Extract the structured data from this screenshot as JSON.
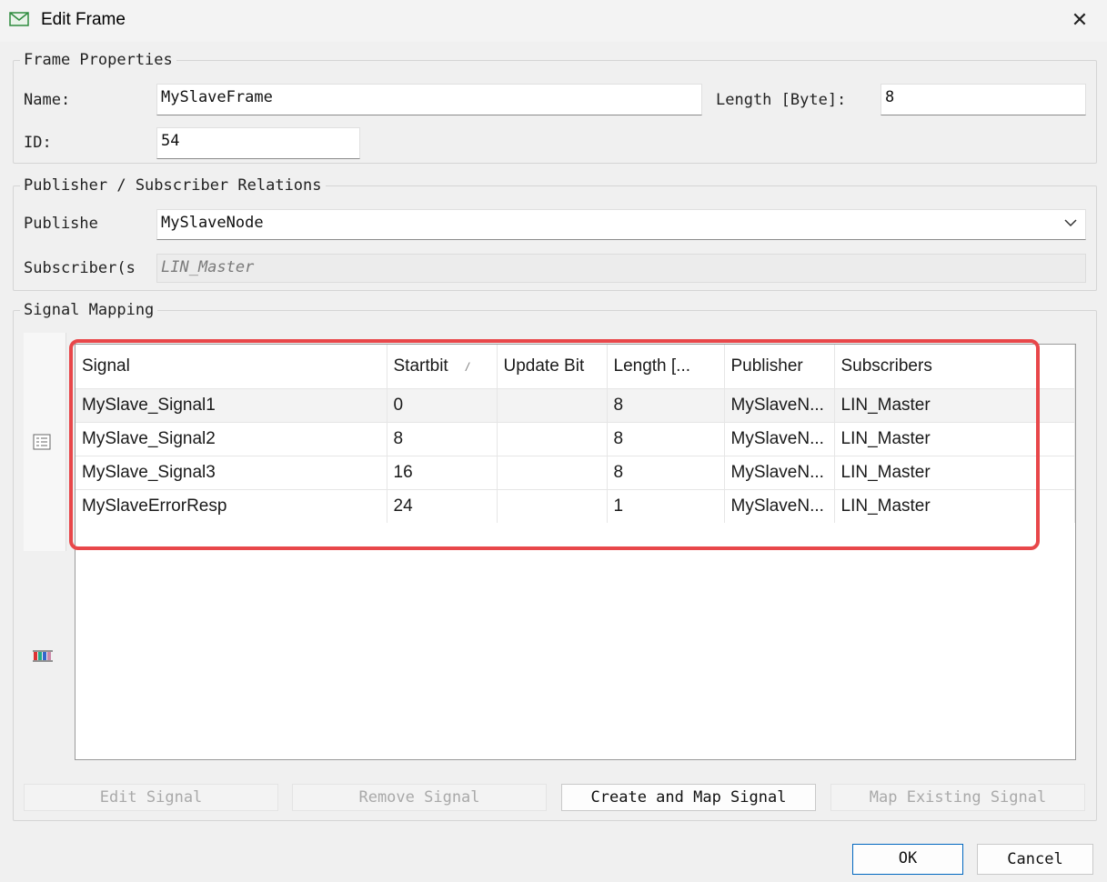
{
  "window": {
    "title": "Edit Frame",
    "close_glyph": "✕"
  },
  "frame_properties": {
    "legend": "Frame Properties",
    "name_label": "Name:",
    "name_value": "MySlaveFrame",
    "length_label": "Length [Byte]:",
    "length_value": "8",
    "id_label": "ID:",
    "id_value": "54"
  },
  "relations": {
    "legend": "Publisher / Subscriber Relations",
    "publisher_label": "Publishe",
    "publisher_value": "MySlaveNode",
    "subscriber_label": "Subscriber(s",
    "subscriber_value": "LIN_Master"
  },
  "signal_mapping": {
    "legend": "Signal Mapping",
    "columns": [
      "Signal",
      "Startbit",
      "Update Bit",
      "Length [...",
      "Publisher",
      "Subscribers"
    ],
    "sort_glyph": "/",
    "rows": [
      [
        "MySlave_Signal1",
        "0",
        "",
        "8",
        "MySlaveN...",
        "LIN_Master"
      ],
      [
        "MySlave_Signal2",
        "8",
        "",
        "8",
        "MySlaveN...",
        "LIN_Master"
      ],
      [
        "MySlave_Signal3",
        "16",
        "",
        "8",
        "MySlaveN...",
        "LIN_Master"
      ],
      [
        "MySlaveErrorResp",
        "24",
        "",
        "1",
        "MySlaveN...",
        "LIN_Master"
      ]
    ],
    "sidebar_icons": [
      "list-view-icon",
      "color-bars-icon"
    ]
  },
  "buttons": {
    "edit_signal": "Edit Signal",
    "remove_signal": "Remove Signal",
    "create_map_signal": "Create and Map Signal",
    "map_existing_signal": "Map Existing Signal",
    "ok": "OK",
    "cancel": "Cancel"
  },
  "colors": {
    "highlight": "#e8474a",
    "primary_border": "#0067c0"
  }
}
